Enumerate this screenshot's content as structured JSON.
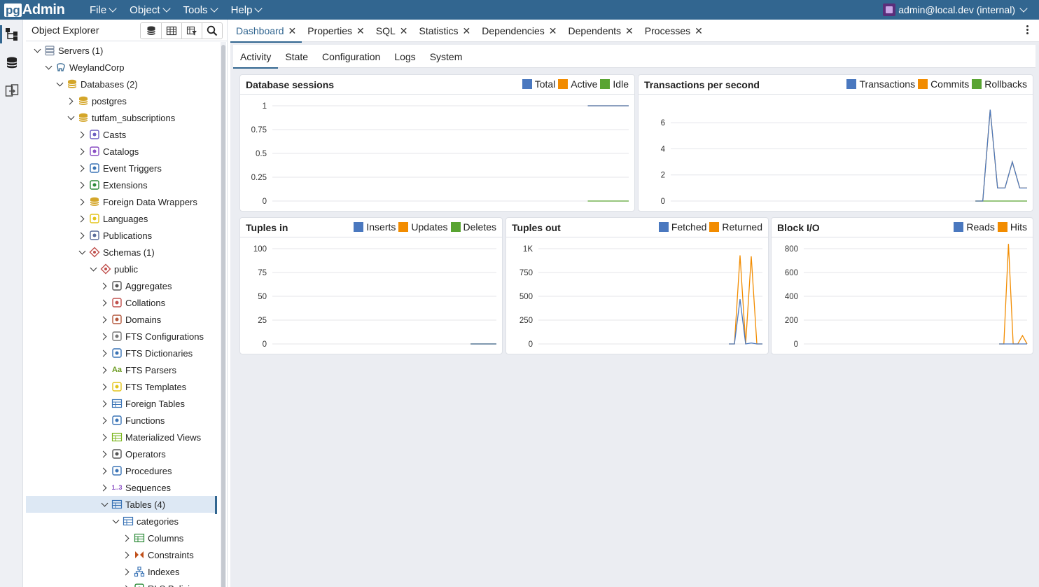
{
  "app": {
    "logo_pg": "pg",
    "logo_admin": "Admin",
    "menu": [
      {
        "label": "File"
      },
      {
        "label": "Object"
      },
      {
        "label": "Tools"
      },
      {
        "label": "Help"
      }
    ],
    "user": "admin@local.dev (internal)"
  },
  "explorer": {
    "title": "Object Explorer",
    "tree": [
      {
        "label": "Servers (1)",
        "depth": 0,
        "state": "open",
        "icon": "servers-icon",
        "icolor": "#7b8aa0"
      },
      {
        "label": "WeylandCorp",
        "depth": 1,
        "state": "open",
        "icon": "elephant-icon",
        "icolor": "#336791"
      },
      {
        "label": "Databases (2)",
        "depth": 2,
        "state": "open",
        "icon": "databases-icon",
        "icolor": "#d4a62a"
      },
      {
        "label": "postgres",
        "depth": 3,
        "state": "closed",
        "icon": "database-icon",
        "icolor": "#d4a62a"
      },
      {
        "label": "tutfam_subscriptions",
        "depth": 3,
        "state": "open",
        "icon": "database-icon",
        "icolor": "#d4a62a"
      },
      {
        "label": "Casts",
        "depth": 4,
        "state": "closed",
        "icon": "casts-icon",
        "icolor": "#6d5fc1"
      },
      {
        "label": "Catalogs",
        "depth": 4,
        "state": "closed",
        "icon": "catalogs-icon",
        "icolor": "#8a4fc4"
      },
      {
        "label": "Event Triggers",
        "depth": 4,
        "state": "closed",
        "icon": "event-triggers-icon",
        "icolor": "#3a73b5"
      },
      {
        "label": "Extensions",
        "depth": 4,
        "state": "closed",
        "icon": "extensions-icon",
        "icolor": "#2e8b3a"
      },
      {
        "label": "Foreign Data Wrappers",
        "depth": 4,
        "state": "closed",
        "icon": "fdw-icon",
        "icolor": "#d4a62a"
      },
      {
        "label": "Languages",
        "depth": 4,
        "state": "closed",
        "icon": "languages-icon",
        "icolor": "#e3c41a"
      },
      {
        "label": "Publications",
        "depth": 4,
        "state": "closed",
        "icon": "publications-icon",
        "icolor": "#5a6c9a"
      },
      {
        "label": "Schemas (1)",
        "depth": 4,
        "state": "open",
        "icon": "schemas-icon",
        "icolor": "#c0504d"
      },
      {
        "label": "public",
        "depth": 5,
        "state": "open",
        "icon": "schema-icon",
        "icolor": "#c0504d"
      },
      {
        "label": "Aggregates",
        "depth": 6,
        "state": "closed",
        "icon": "aggregates-icon",
        "icolor": "#555555"
      },
      {
        "label": "Collations",
        "depth": 6,
        "state": "closed",
        "icon": "collations-icon",
        "icolor": "#c0504d"
      },
      {
        "label": "Domains",
        "depth": 6,
        "state": "closed",
        "icon": "domains-icon",
        "icolor": "#b4573c"
      },
      {
        "label": "FTS Configurations",
        "depth": 6,
        "state": "closed",
        "icon": "fts-configurations-icon",
        "icolor": "#777777"
      },
      {
        "label": "FTS Dictionaries",
        "depth": 6,
        "state": "closed",
        "icon": "fts-dictionaries-icon",
        "icolor": "#3a73b5"
      },
      {
        "label": "FTS Parsers",
        "depth": 6,
        "state": "closed",
        "icon": "fts-parsers-icon",
        "icolor": "#6a9a1f",
        "glyph": "Aa"
      },
      {
        "label": "FTS Templates",
        "depth": 6,
        "state": "closed",
        "icon": "fts-templates-icon",
        "icolor": "#e3c41a"
      },
      {
        "label": "Foreign Tables",
        "depth": 6,
        "state": "closed",
        "icon": "foreign-tables-icon",
        "icolor": "#3a73b5"
      },
      {
        "label": "Functions",
        "depth": 6,
        "state": "closed",
        "icon": "functions-icon",
        "icolor": "#3a73b5"
      },
      {
        "label": "Materialized Views",
        "depth": 6,
        "state": "closed",
        "icon": "materialized-views-icon",
        "icolor": "#7ab51d"
      },
      {
        "label": "Operators",
        "depth": 6,
        "state": "closed",
        "icon": "operators-icon",
        "icolor": "#555555"
      },
      {
        "label": "Procedures",
        "depth": 6,
        "state": "closed",
        "icon": "procedures-icon",
        "icolor": "#3a73b5"
      },
      {
        "label": "Sequences",
        "depth": 6,
        "state": "closed",
        "icon": "sequences-icon",
        "icolor": "#8a4fc4",
        "glyph": "1..3"
      },
      {
        "label": "Tables (4)",
        "depth": 6,
        "state": "open",
        "icon": "tables-icon",
        "icolor": "#3a73b5",
        "selected": true
      },
      {
        "label": "categories",
        "depth": 7,
        "state": "open",
        "icon": "table-icon",
        "icolor": "#3a73b5"
      },
      {
        "label": "Columns",
        "depth": 8,
        "state": "closed",
        "icon": "columns-icon",
        "icolor": "#2e8b3a"
      },
      {
        "label": "Constraints",
        "depth": 8,
        "state": "closed",
        "icon": "constraints-icon",
        "icolor": "#c0501a"
      },
      {
        "label": "Indexes",
        "depth": 8,
        "state": "closed",
        "icon": "indexes-icon",
        "icolor": "#3a73b5"
      },
      {
        "label": "RLS Policies",
        "depth": 8,
        "state": "closed",
        "icon": "rls-policies-icon",
        "icolor": "#2e8b3a"
      }
    ]
  },
  "tabs": [
    {
      "label": "Dashboard",
      "active": true
    },
    {
      "label": "Properties"
    },
    {
      "label": "SQL"
    },
    {
      "label": "Statistics"
    },
    {
      "label": "Dependencies"
    },
    {
      "label": "Dependents"
    },
    {
      "label": "Processes"
    }
  ],
  "subtabs": [
    {
      "label": "Activity",
      "active": true
    },
    {
      "label": "State"
    },
    {
      "label": "Configuration"
    },
    {
      "label": "Logs"
    },
    {
      "label": "System"
    }
  ],
  "colors": {
    "blue": "#4a78bf",
    "orange": "#f28c00",
    "green": "#59a432",
    "header": "#326690"
  },
  "chart_data": [
    {
      "id": "db_sessions",
      "type": "line",
      "title": "Database sessions",
      "legend": [
        "Total",
        "Active",
        "Idle"
      ],
      "y_ticks": [
        "1",
        "0.75",
        "0.5",
        "0.25",
        "0"
      ],
      "ylim": [
        0,
        1
      ],
      "series": [
        {
          "name": "Total",
          "color": "blue",
          "values": [
            1,
            1,
            1,
            1,
            1
          ]
        },
        {
          "name": "Active",
          "color": "orange",
          "values": [
            1,
            1,
            1,
            1,
            1
          ]
        },
        {
          "name": "Idle",
          "color": "green",
          "values": [
            0,
            0,
            0,
            0,
            0
          ]
        }
      ],
      "x_start_fraction": 0.885
    },
    {
      "id": "tps",
      "type": "line",
      "title": "Transactions per second",
      "legend": [
        "Transactions",
        "Commits",
        "Rollbacks"
      ],
      "y_ticks": [
        "6",
        "4",
        "2",
        "0"
      ],
      "ylim": [
        0,
        7.3
      ],
      "series": [
        {
          "name": "Transactions",
          "color": "blue",
          "values": [
            0,
            0,
            7,
            1,
            1,
            3,
            1,
            1
          ]
        },
        {
          "name": "Commits",
          "color": "orange",
          "values": [
            0,
            0,
            7,
            1,
            1,
            3,
            1,
            1
          ]
        },
        {
          "name": "Rollbacks",
          "color": "green",
          "values": [
            0,
            0,
            0,
            0,
            0,
            0,
            0,
            0
          ]
        }
      ],
      "x_start_fraction": 0.855
    },
    {
      "id": "tuples_in",
      "type": "line",
      "title": "Tuples in",
      "legend": [
        "Inserts",
        "Updates",
        "Deletes"
      ],
      "y_ticks": [
        "100",
        "75",
        "50",
        "25",
        "0"
      ],
      "ylim": [
        0,
        100
      ],
      "series": [
        {
          "name": "Inserts",
          "color": "blue",
          "values": [
            0,
            0,
            0,
            0,
            0
          ]
        },
        {
          "name": "Updates",
          "color": "orange",
          "values": [
            0,
            0,
            0,
            0,
            0
          ]
        },
        {
          "name": "Deletes",
          "color": "green",
          "values": [
            0,
            0,
            0,
            0,
            0
          ]
        }
      ],
      "x_start_fraction": 0.885
    },
    {
      "id": "tuples_out",
      "type": "line",
      "title": "Tuples out",
      "legend": [
        "Fetched",
        "Returned"
      ],
      "y_ticks": [
        "1K",
        "750",
        "500",
        "250",
        "0"
      ],
      "ylim": [
        0,
        1000
      ],
      "series": [
        {
          "name": "Fetched",
          "color": "blue",
          "values": [
            0,
            0,
            470,
            0,
            10,
            0,
            0
          ]
        },
        {
          "name": "Returned",
          "color": "orange",
          "values": [
            0,
            0,
            930,
            0,
            920,
            0,
            0
          ]
        }
      ],
      "x_start_fraction": 0.85
    },
    {
      "id": "block_io",
      "type": "line",
      "title": "Block I/O",
      "legend": [
        "Reads",
        "Hits"
      ],
      "y_ticks": [
        "800",
        "600",
        "400",
        "200",
        "0"
      ],
      "ylim": [
        0,
        800
      ],
      "series": [
        {
          "name": "Reads",
          "color": "blue",
          "values": [
            0,
            0,
            0,
            0,
            0,
            0,
            0
          ]
        },
        {
          "name": "Hits",
          "color": "orange",
          "values": [
            0,
            0,
            840,
            0,
            0,
            70,
            0
          ]
        }
      ],
      "x_start_fraction": 0.875
    }
  ]
}
